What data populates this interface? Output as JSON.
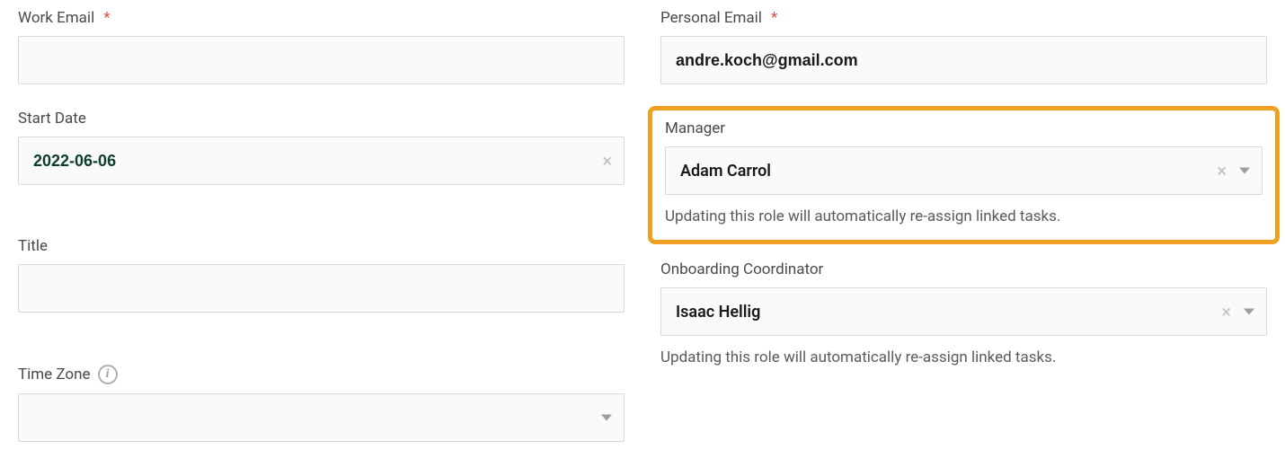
{
  "left": {
    "work_email": {
      "label": "Work Email",
      "required_mark": "*",
      "value": ""
    },
    "start_date": {
      "label": "Start Date",
      "value": "2022-06-06"
    },
    "title": {
      "label": "Title",
      "value": ""
    },
    "time_zone": {
      "label": "Time Zone",
      "value": ""
    }
  },
  "right": {
    "personal_email": {
      "label": "Personal Email",
      "required_mark": "*",
      "value": "andre.koch@gmail.com"
    },
    "manager": {
      "label": "Manager",
      "value": "Adam Carrol",
      "helper": "Updating this role will automatically re-assign linked tasks."
    },
    "onboarding_coordinator": {
      "label": "Onboarding Coordinator",
      "value": "Isaac Hellig",
      "helper": "Updating this role will automatically re-assign linked tasks."
    }
  }
}
